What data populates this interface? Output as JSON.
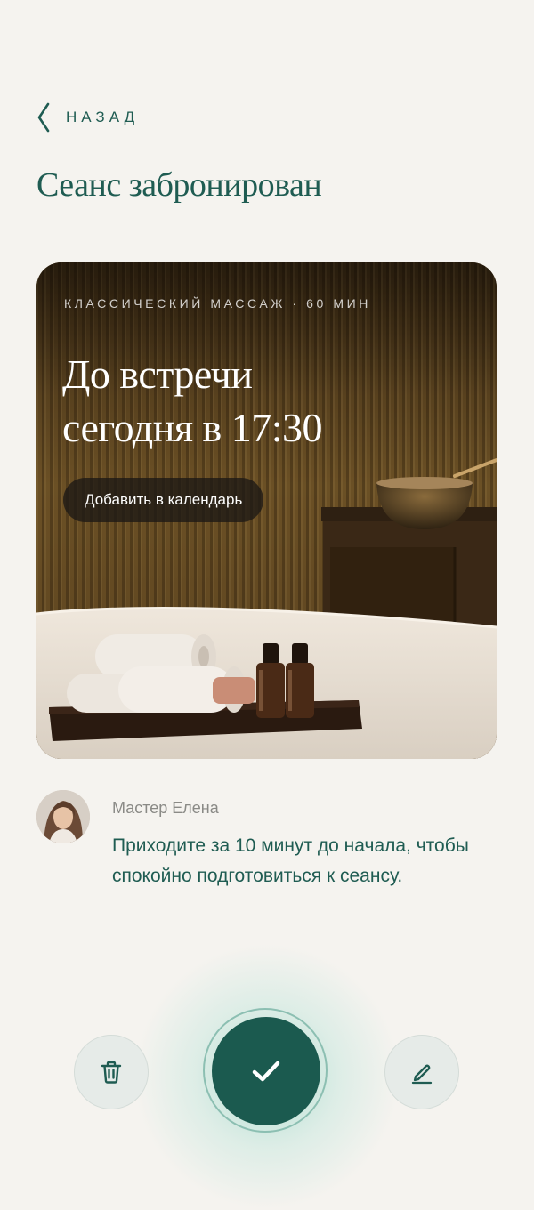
{
  "back": {
    "label": "НАЗАД",
    "icon": "chevron-left-icon"
  },
  "page": {
    "title": "Сеанс забронирован"
  },
  "booking": {
    "service": "КЛАССИЧЕСКИЙ МАССАЖ · 60 МИН",
    "headline_line1": "До встречи",
    "headline_line2": "сегодня в 17:30",
    "calendar_button": "Добавить в календарь"
  },
  "master": {
    "name": "Мастер Елена",
    "message": "Приходите за 10 минут до начала, чтобы спокойно подготовиться к сеансу."
  },
  "actions": {
    "delete_icon": "trash-icon",
    "confirm_icon": "checkmark-icon",
    "edit_icon": "pencil-icon"
  },
  "colors": {
    "background": "#f5f3ef",
    "accent": "#1f5c52",
    "confirm": "#1b5a4f",
    "muted_text": "#8a8a86",
    "secondary_button": "#e6ebe8"
  }
}
